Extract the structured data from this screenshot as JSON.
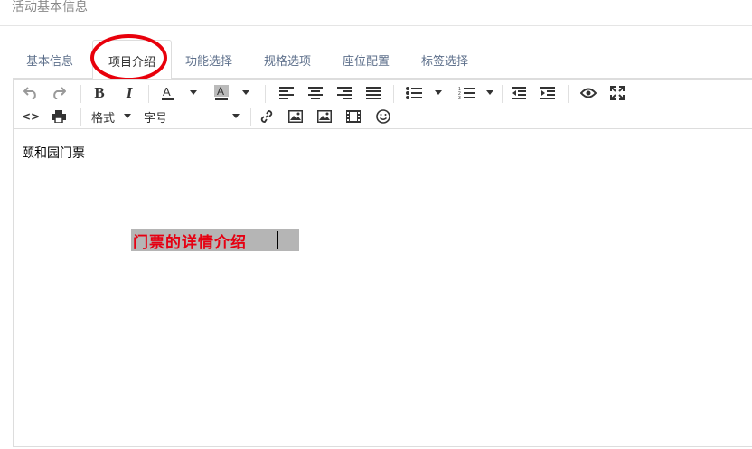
{
  "header": {
    "title": "活动基本信息"
  },
  "tabs": [
    {
      "label": "基本信息"
    },
    {
      "label": "项目介绍"
    },
    {
      "label": "功能选择"
    },
    {
      "label": "规格选项"
    },
    {
      "label": "座位配置"
    },
    {
      "label": "标签选择"
    }
  ],
  "active_tab": "项目介绍",
  "toolbar": {
    "format_label": "格式",
    "fontsize_label": "字号",
    "icons": [
      "undo-icon",
      "redo-icon",
      "bold-icon",
      "italic-icon",
      "text-color-icon",
      "background-color-icon",
      "align-left-icon",
      "align-center-icon",
      "align-right-icon",
      "align-justify-icon",
      "bullet-list-icon",
      "numbered-list-icon",
      "outdent-icon",
      "indent-icon",
      "preview-icon",
      "fullscreen-icon",
      "source-code-icon",
      "print-icon",
      "link-icon",
      "image-icon",
      "image2-icon",
      "media-icon",
      "emoticon-icon"
    ]
  },
  "content": {
    "line1": "颐和园门票",
    "line2": "门票的详情介绍"
  },
  "colors": {
    "highlight_ring": "#e8000b",
    "detail_text": "#e60012",
    "detail_bg": "#b5b5b5"
  }
}
